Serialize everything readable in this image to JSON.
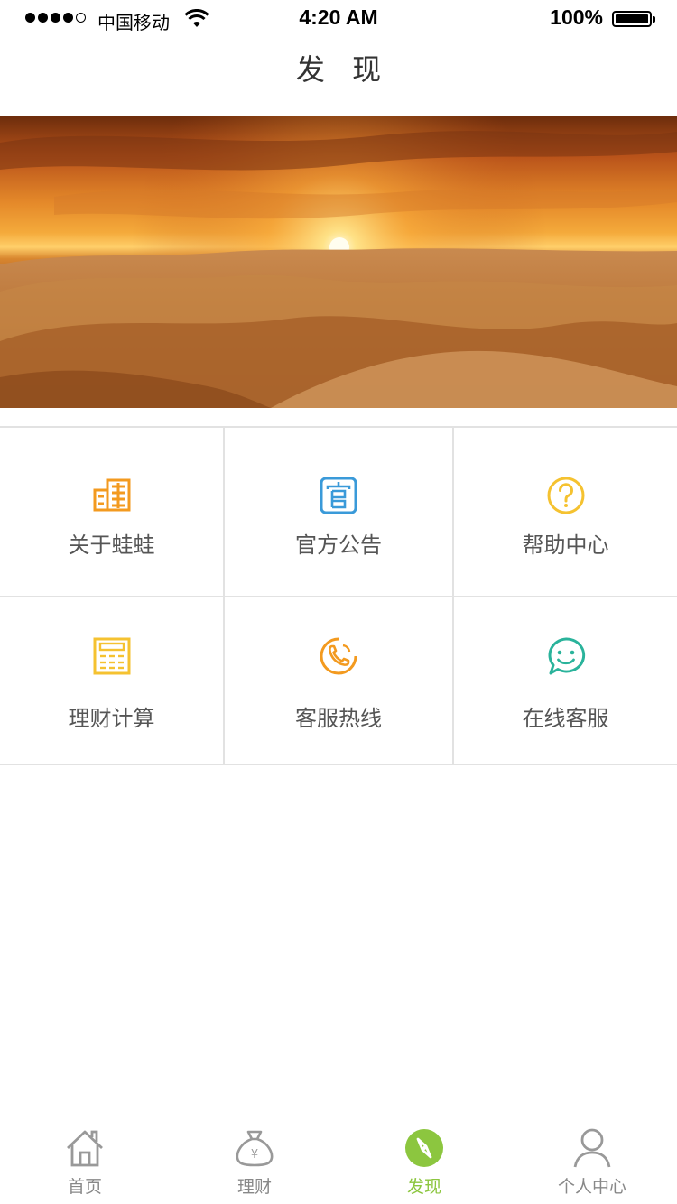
{
  "status_bar": {
    "carrier": "中国移动",
    "time": "4:20 AM",
    "battery_percent": "100%",
    "signal_bars_filled": 4,
    "signal_bars_total": 5,
    "battery_level": 1.0
  },
  "header": {
    "title": "发 现"
  },
  "banner": {
    "image": "desert-sunset-banner"
  },
  "grid": {
    "items": [
      {
        "label": "关于蛙蛙",
        "icon": "building-icon",
        "color": "#F39A1F"
      },
      {
        "label": "官方公告",
        "icon": "notice-icon",
        "color": "#3A9AD9"
      },
      {
        "label": "帮助中心",
        "icon": "question-icon",
        "color": "#F5C230"
      },
      {
        "label": "理财计算",
        "icon": "calculator-icon",
        "color": "#F5C230"
      },
      {
        "label": "客服热线",
        "icon": "phone-icon",
        "color": "#F39A1F"
      },
      {
        "label": "在线客服",
        "icon": "chat-smile-icon",
        "color": "#2AB39B"
      }
    ]
  },
  "tabbar": {
    "tabs": [
      {
        "label": "首页",
        "icon": "home-icon",
        "active": false
      },
      {
        "label": "理财",
        "icon": "money-bag-icon",
        "active": false
      },
      {
        "label": "发现",
        "icon": "compass-icon",
        "active": true
      },
      {
        "label": "个人中心",
        "icon": "user-icon",
        "active": false
      }
    ],
    "active_color": "#8CC63F",
    "inactive_color": "#888888"
  }
}
